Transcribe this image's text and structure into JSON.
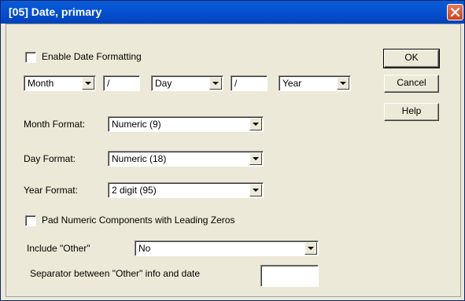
{
  "window": {
    "title": "[05] Date, primary"
  },
  "enable_date_formatting": {
    "label": "Enable Date Formatting",
    "checked": false
  },
  "date_order": {
    "first": "Month",
    "sep1": "/",
    "second": "Day",
    "sep2": "/",
    "third": "Year"
  },
  "month_format": {
    "label": "Month Format:",
    "value": "Numeric (9)"
  },
  "day_format": {
    "label": "Day Format:",
    "value": "Numeric (18)"
  },
  "year_format": {
    "label": "Year Format:",
    "value": "2 digit (95)"
  },
  "pad_zeros": {
    "label": "Pad Numeric Components with Leading Zeros",
    "checked": false
  },
  "include_other": {
    "label": "Include \"Other\"",
    "value": "No"
  },
  "separator_other": {
    "label": "Separator between \"Other\" info and date",
    "value": ""
  },
  "buttons": {
    "ok": "OK",
    "cancel": "Cancel",
    "help": "Help"
  },
  "icons": {
    "close": "close-icon",
    "dropdown": "chevron-down-icon"
  },
  "colors": {
    "titlebar": "#0452d1",
    "face": "#ece9d8",
    "close": "#c8451f"
  }
}
